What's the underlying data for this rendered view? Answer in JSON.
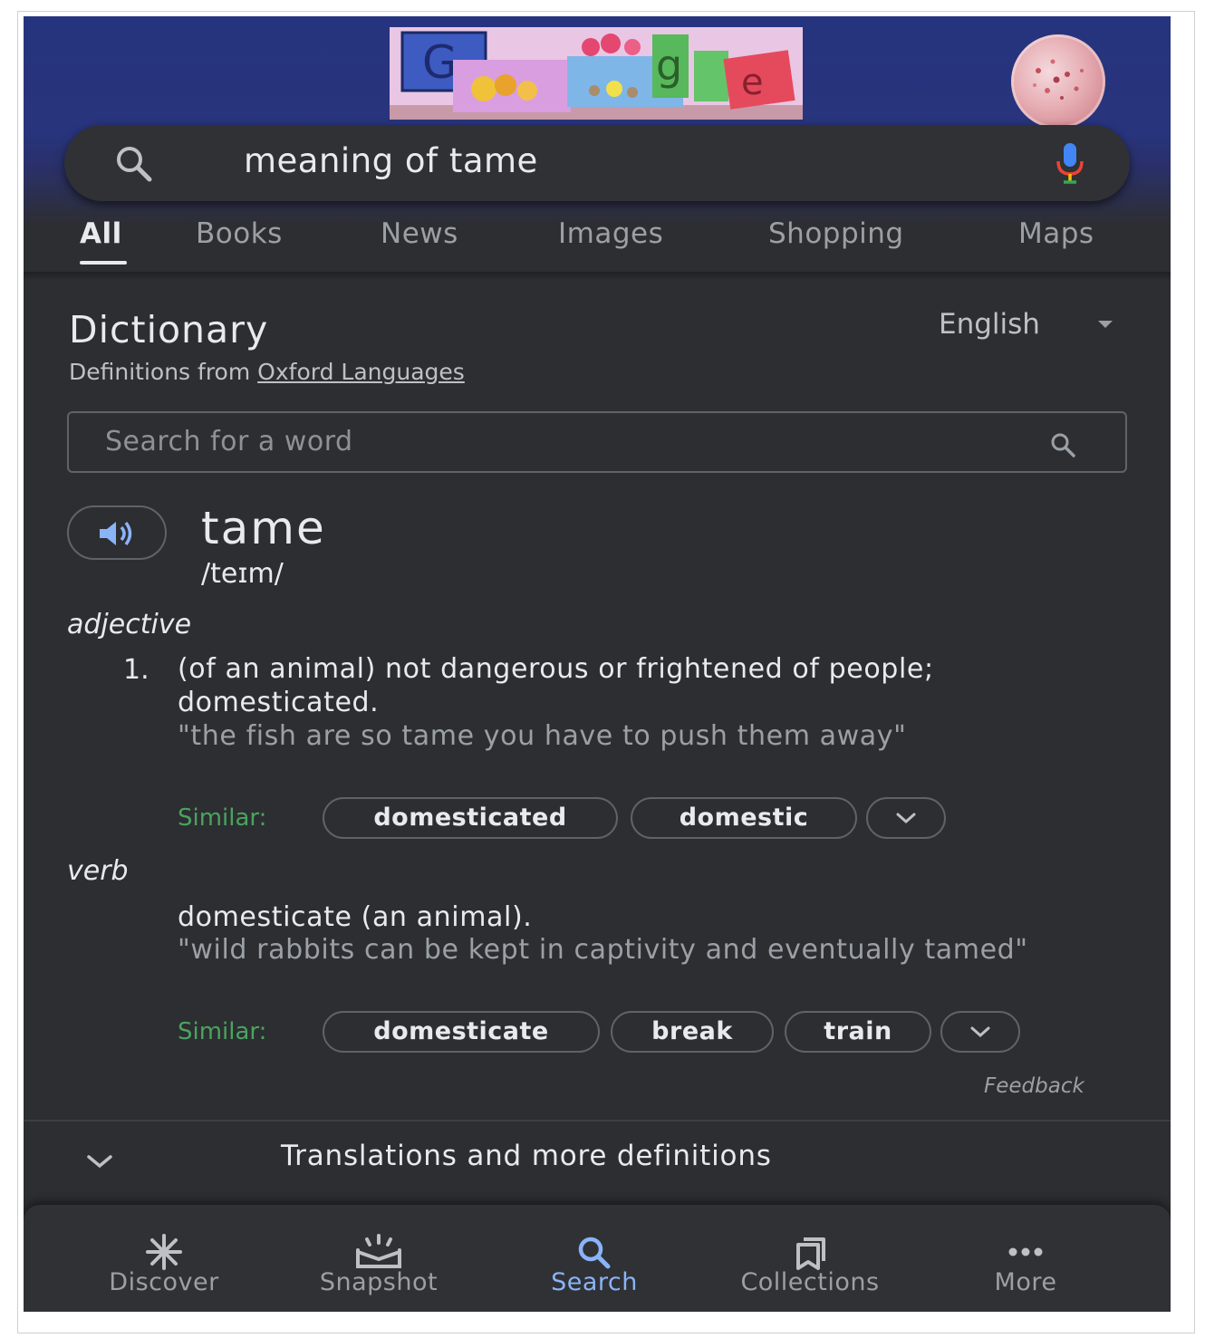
{
  "search": {
    "query": "meaning of tame"
  },
  "tabs": [
    {
      "label": "All",
      "active": true
    },
    {
      "label": "Books"
    },
    {
      "label": "News"
    },
    {
      "label": "Images"
    },
    {
      "label": "Shopping"
    },
    {
      "label": "Maps"
    }
  ],
  "dictionary": {
    "title": "Dictionary",
    "language": "English",
    "source_prefix": "Definitions from",
    "source_link": "Oxford Languages",
    "word_search_placeholder": "Search for a word",
    "headword": "tame",
    "phonetic": "/teɪm/",
    "adjective": {
      "pos": "adjective",
      "number": "1.",
      "definition": "(of an animal) not dangerous or frightened of people; domesticated.",
      "example": "\"the fish are so tame you have to push them away\"",
      "similar_label": "Similar:",
      "similar": [
        "domesticated",
        "domestic"
      ]
    },
    "verb": {
      "pos": "verb",
      "definition": "domesticate (an animal).",
      "example": "\"wild rabbits can be kept in captivity and eventually tamed\"",
      "similar_label": "Similar:",
      "similar": [
        "domesticate",
        "break",
        "train"
      ]
    },
    "feedback": "Feedback",
    "more_definitions": "Translations and more definitions"
  },
  "bottom_nav": [
    {
      "label": "Discover",
      "icon": "asterisk-icon"
    },
    {
      "label": "Snapshot",
      "icon": "snapshot-icon"
    },
    {
      "label": "Search",
      "icon": "search-icon",
      "active": true
    },
    {
      "label": "Collections",
      "icon": "collections-icon"
    },
    {
      "label": "More",
      "icon": "more-dots-icon"
    }
  ],
  "colors": {
    "background": "#2d2e31",
    "header_blue": "#26347f",
    "accent_blue": "#8ab4f8",
    "similar_green": "#49a45f",
    "text_primary": "#e8eaed",
    "text_secondary": "#9aa0a6"
  }
}
